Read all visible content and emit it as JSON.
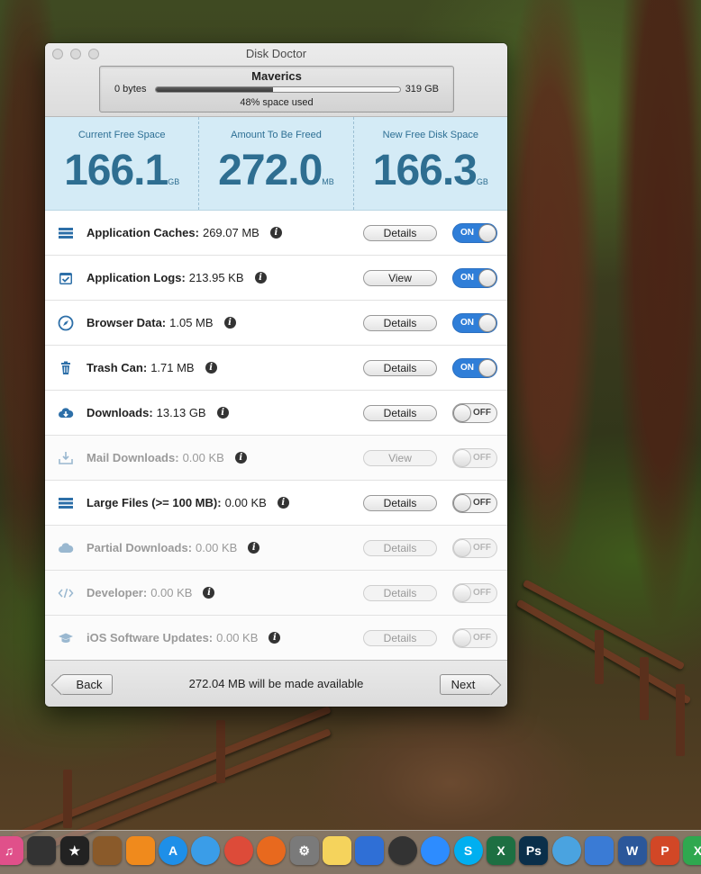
{
  "window": {
    "title": "Disk Doctor"
  },
  "disk": {
    "name": "Maverics",
    "min_label": "0 bytes",
    "max_label": "319 GB",
    "used_label": "48% space used",
    "used_fraction": 0.48
  },
  "stats": [
    {
      "label": "Current Free Space",
      "value": "166.1",
      "unit": "GB"
    },
    {
      "label": "Amount To Be Freed",
      "value": "272.0",
      "unit": "MB"
    },
    {
      "label": "New Free Disk Space",
      "value": "166.3",
      "unit": "GB"
    }
  ],
  "items": [
    {
      "name": "Application Caches:",
      "size": "269.07 MB",
      "button": "Details",
      "toggle": "ON",
      "enabled": true,
      "icon": "stack-icon"
    },
    {
      "name": "Application Logs:",
      "size": "213.95 KB",
      "button": "View",
      "toggle": "ON",
      "enabled": true,
      "icon": "calendar-check-icon"
    },
    {
      "name": "Browser Data:",
      "size": "1.05 MB",
      "button": "Details",
      "toggle": "ON",
      "enabled": true,
      "icon": "compass-icon"
    },
    {
      "name": "Trash Can:",
      "size": "1.71 MB",
      "button": "Details",
      "toggle": "ON",
      "enabled": true,
      "icon": "trash-icon"
    },
    {
      "name": "Downloads:",
      "size": "13.13 GB",
      "button": "Details",
      "toggle": "OFF",
      "enabled": true,
      "icon": "cloud-download-icon"
    },
    {
      "name": "Mail Downloads:",
      "size": "0.00 KB",
      "button": "View",
      "toggle": "OFF",
      "enabled": false,
      "icon": "tray-download-icon"
    },
    {
      "name": "Large Files (>= 100 MB):",
      "size": "0.00 KB",
      "button": "Details",
      "toggle": "OFF",
      "enabled": true,
      "icon": "stack-icon"
    },
    {
      "name": "Partial Downloads:",
      "size": "0.00 KB",
      "button": "Details",
      "toggle": "OFF",
      "enabled": false,
      "icon": "cloud-icon"
    },
    {
      "name": "Developer:",
      "size": "0.00 KB",
      "button": "Details",
      "toggle": "OFF",
      "enabled": false,
      "icon": "code-icon"
    },
    {
      "name": "iOS Software Updates:",
      "size": "0.00 KB",
      "button": "Details",
      "toggle": "OFF",
      "enabled": false,
      "icon": "graduation-cap-icon"
    }
  ],
  "footer": {
    "back_label": "Back",
    "next_label": "Next",
    "message": "272.04 MB will be made available"
  },
  "colors": {
    "accent": "#2f7ed8",
    "stats_bg": "#d4ebf6",
    "stats_text": "#2e6e91"
  },
  "dock": [
    {
      "name": "itunes-icon",
      "color": "#e0508a",
      "glyph": "♫"
    },
    {
      "name": "final-cut-icon",
      "color": "#333333",
      "glyph": ""
    },
    {
      "name": "imovie-star-icon",
      "color": "#222222",
      "glyph": "★"
    },
    {
      "name": "garageband-icon",
      "color": "#8a5a2a",
      "glyph": ""
    },
    {
      "name": "ibooks-icon",
      "color": "#f08a1c",
      "glyph": ""
    },
    {
      "name": "app-store-icon",
      "color": "#1e8fe8",
      "glyph": "A"
    },
    {
      "name": "safari-icon",
      "color": "#3a9de8",
      "glyph": ""
    },
    {
      "name": "chrome-icon",
      "color": "#dd4b39",
      "glyph": ""
    },
    {
      "name": "firefox-icon",
      "color": "#e8691e",
      "glyph": ""
    },
    {
      "name": "system-preferences-icon",
      "color": "#7a7a7a",
      "glyph": "⚙"
    },
    {
      "name": "notes-icon",
      "color": "#f5d35c",
      "glyph": ""
    },
    {
      "name": "keynote-icon",
      "color": "#2f6fd6",
      "glyph": ""
    },
    {
      "name": "dvd-player-icon",
      "color": "#333333",
      "glyph": ""
    },
    {
      "name": "zoom-icon",
      "color": "#2d8cff",
      "glyph": ""
    },
    {
      "name": "skype-icon",
      "color": "#00aff0",
      "glyph": "S"
    },
    {
      "name": "excel-icon",
      "color": "#1d6f42",
      "glyph": "X"
    },
    {
      "name": "photoshop-icon",
      "color": "#0a2f4a",
      "glyph": "Ps"
    },
    {
      "name": "weather-icon",
      "color": "#4aa3e0",
      "glyph": ""
    },
    {
      "name": "monitor-icon",
      "color": "#3a7bd5",
      "glyph": ""
    },
    {
      "name": "word-icon",
      "color": "#2b579a",
      "glyph": "W"
    },
    {
      "name": "powerpoint-icon",
      "color": "#d24726",
      "glyph": "P"
    },
    {
      "name": "x-app-icon",
      "color": "#2fa84f",
      "glyph": "X"
    }
  ]
}
